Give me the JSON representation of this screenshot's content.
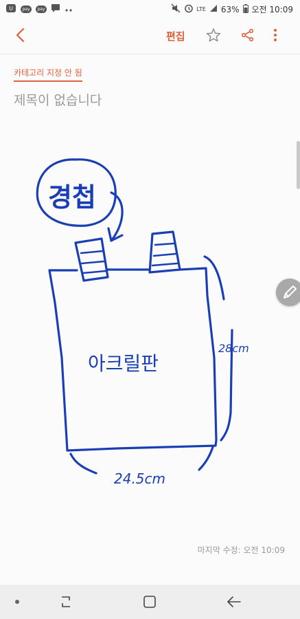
{
  "status_bar": {
    "battery": "63%",
    "time": "오전 10:09",
    "network": "LTE",
    "icons": [
      "notification-icon",
      "pay-icon",
      "pay-icon",
      "chat-icon",
      "more-dots-icon",
      "mute-icon",
      "alarm-icon",
      "lte-icon",
      "signal-icon",
      "battery-icon"
    ]
  },
  "app_bar": {
    "edit_label": "편집",
    "icons": [
      "back-arrow-icon",
      "star-icon",
      "share-icon",
      "more-vert-icon"
    ]
  },
  "note": {
    "category": "카테고리 지정 안 됨",
    "title": "제목이 없습니다",
    "drawing": {
      "circle_text": "경첩",
      "panel_text": "아크릴판",
      "height_label": "28cm",
      "width_label": "24.5cm"
    },
    "modified": "마지막 수정: 오전 10:09"
  },
  "colors": {
    "accent": "#e0603c",
    "ink": "#1a3fb5"
  },
  "nav_bar": {
    "icons": [
      "nav-dot-icon",
      "recent-apps-icon",
      "home-icon",
      "back-icon"
    ]
  }
}
